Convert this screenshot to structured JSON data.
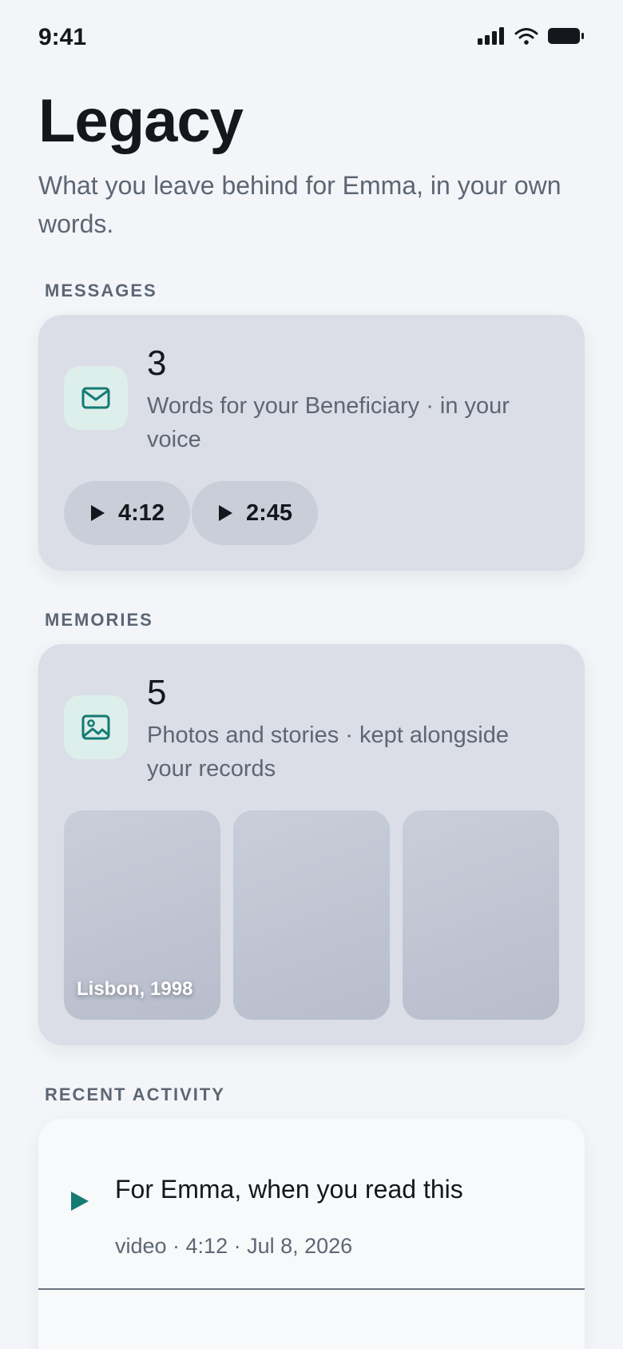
{
  "status_bar": {
    "time": "9:41",
    "icons": [
      "cellular-signal-icon",
      "wifi-icon",
      "battery-icon"
    ]
  },
  "header": {
    "title": "Legacy",
    "subtitle": "What you leave behind for Emma, in your own words."
  },
  "messages": {
    "section_label": "MESSAGES",
    "icon": "mail-icon",
    "count": "3",
    "description": "Words for your Beneficiary · in your voice",
    "clips": [
      {
        "duration": "4:12",
        "icon": "play-icon"
      },
      {
        "duration": "2:45",
        "icon": "play-icon"
      }
    ]
  },
  "memories": {
    "section_label": "MEMORIES",
    "icon": "image-icon",
    "count": "5",
    "description": "Photos and stories · kept alongside your records",
    "photos": [
      {
        "caption": "Lisbon, 1998"
      },
      {
        "caption": ""
      },
      {
        "caption": ""
      }
    ]
  },
  "recent_activity": {
    "section_label": "RECENT ACTIVITY",
    "items": [
      {
        "icon": "play-icon",
        "title": "For Emma, when you read this",
        "meta": "video · 4:12 · Jul 8, 2026"
      }
    ]
  },
  "colors": {
    "accent": "#157a74",
    "background": "#f3f5f8",
    "card": "#dbdee6",
    "icon_tile": "#dcefeb",
    "muted_text": "#5d6674"
  }
}
